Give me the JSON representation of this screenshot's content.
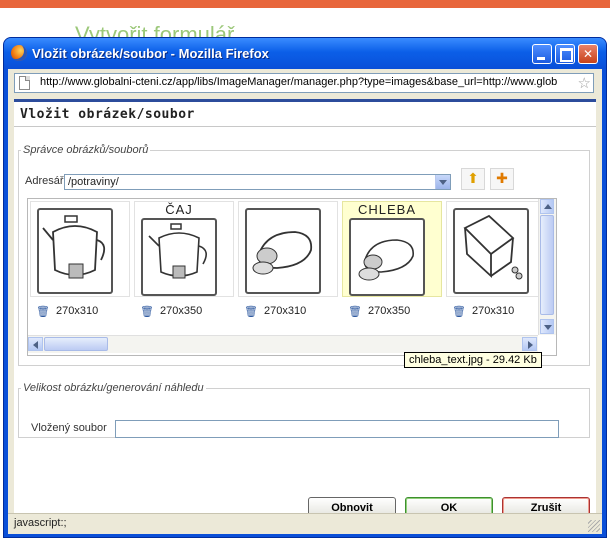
{
  "background": {
    "heading": "Vytvořit formulář"
  },
  "window": {
    "title": "Vložit obrázek/soubor - Mozilla Firefox",
    "url": "http://www.globalni-cteni.cz/app/libs/ImageManager/manager.php?type=images&base_url=http://www.glob",
    "status": "javascript:;"
  },
  "dialog": {
    "title": "Vložit obrázek/soubor",
    "manager": {
      "legend": "Správce obrázků/souborů",
      "directory_label": "Adresář",
      "directory_value": "/potraviny/",
      "images": [
        {
          "caption": "",
          "dimensions": "270x310"
        },
        {
          "caption": "ČAJ",
          "dimensions": "270x350"
        },
        {
          "caption": "",
          "dimensions": "270x310"
        },
        {
          "caption": "CHLEBA",
          "dimensions": "270x350"
        },
        {
          "caption": "",
          "dimensions": "270x310"
        }
      ],
      "tooltip": "chleba_text.jpg - 29.42 Kb"
    },
    "size": {
      "legend": "Velikost obrázku/generování náhledu",
      "file_label": "Vložený soubor",
      "file_value": ""
    },
    "buttons": {
      "refresh": "Obnovit",
      "ok": "OK",
      "cancel": "Zrušit"
    }
  },
  "colors": {
    "titlebar": "#0a4fd8",
    "accent_top": "#e8663c",
    "ok_border": "#3e8f2e",
    "cancel_border": "#aa3333"
  }
}
